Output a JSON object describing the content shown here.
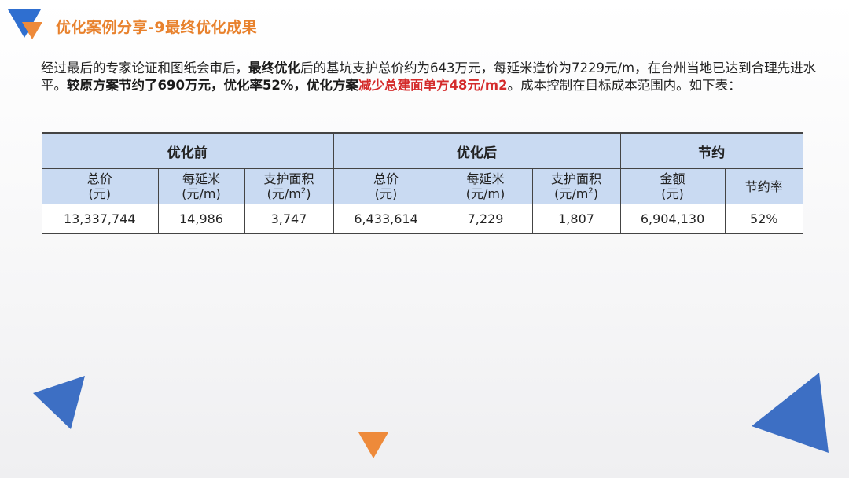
{
  "header": {
    "title": "优化案例分享-9最终优化成果"
  },
  "paragraph": {
    "p1": "经过最后的专家论证和图纸会审后，",
    "p2": "最终优化",
    "p3": "后的基坑支护总价约为643万元，每延米造价为7229元/m，在台州当地已达到合理先进水平。",
    "p4": "较原方案节约了690万元，优化率52%，优化方案",
    "p5": "减少总建面单方48元/m2",
    "p6": "。成本控制在目标成本范围内。如下表："
  },
  "table": {
    "groups": [
      "优化前",
      "优化后",
      "节约"
    ],
    "sub": {
      "total": "总价",
      "unit_yuan": "(元)",
      "per_meter": "每延米",
      "unit_yuan_m": "(元/m)",
      "area": "支护面积",
      "unit_yuan_m2_prefix": "(元/m",
      "unit_sup": "2",
      "unit_close": ")",
      "amount": "金额",
      "rate": "节约率"
    },
    "values": [
      "13,337,744",
      "14,986",
      "3,747",
      "6,433,614",
      "7,229",
      "1,807",
      "6,904,130",
      "52%"
    ]
  },
  "colors": {
    "title": "#e8812c",
    "header_fill": "#c9daf2",
    "highlight_red": "#d42b2b",
    "deco_blue": "#3d6fc4",
    "deco_orange": "#ee8a3a"
  }
}
